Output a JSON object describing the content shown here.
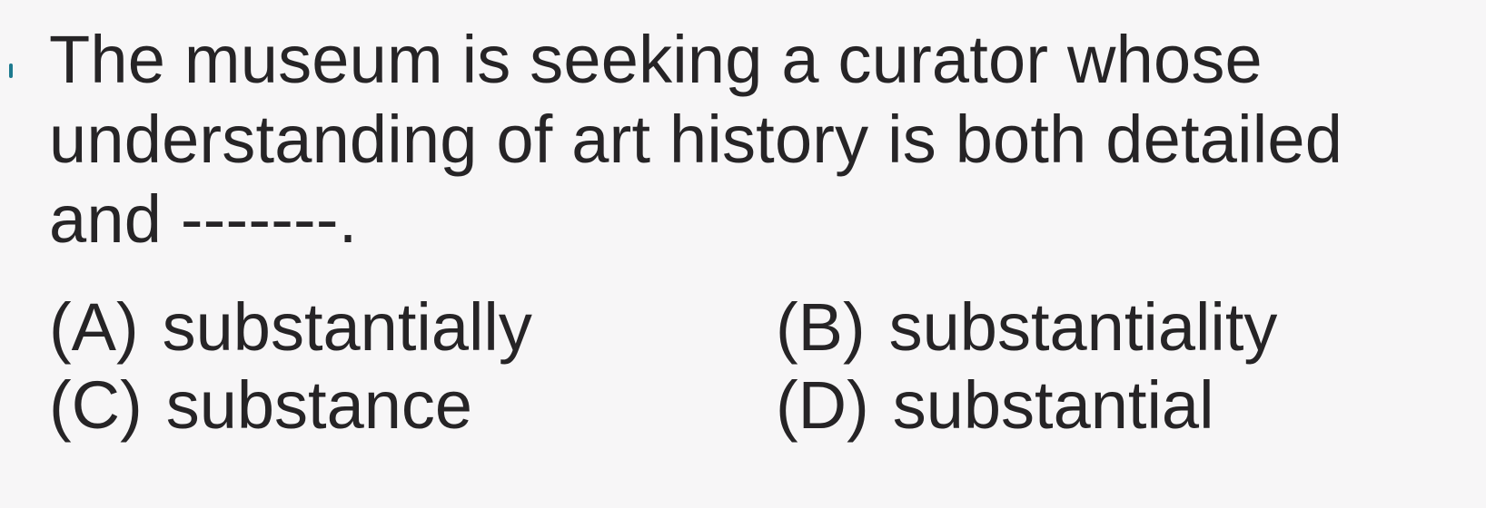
{
  "question": {
    "line1": "The museum is seeking a curator whose",
    "line2": "understanding of art history is both detailed",
    "line3": "and -------."
  },
  "options": [
    {
      "letter": "(A)",
      "text": "substantially"
    },
    {
      "letter": "(B)",
      "text": "substantiality"
    },
    {
      "letter": "(C)",
      "text": "substance"
    },
    {
      "letter": "(D)",
      "text": "substantial"
    }
  ],
  "colors": {
    "background": "#f7f6f7",
    "text": "#262426",
    "edge_mark": "#1d7a8f"
  }
}
